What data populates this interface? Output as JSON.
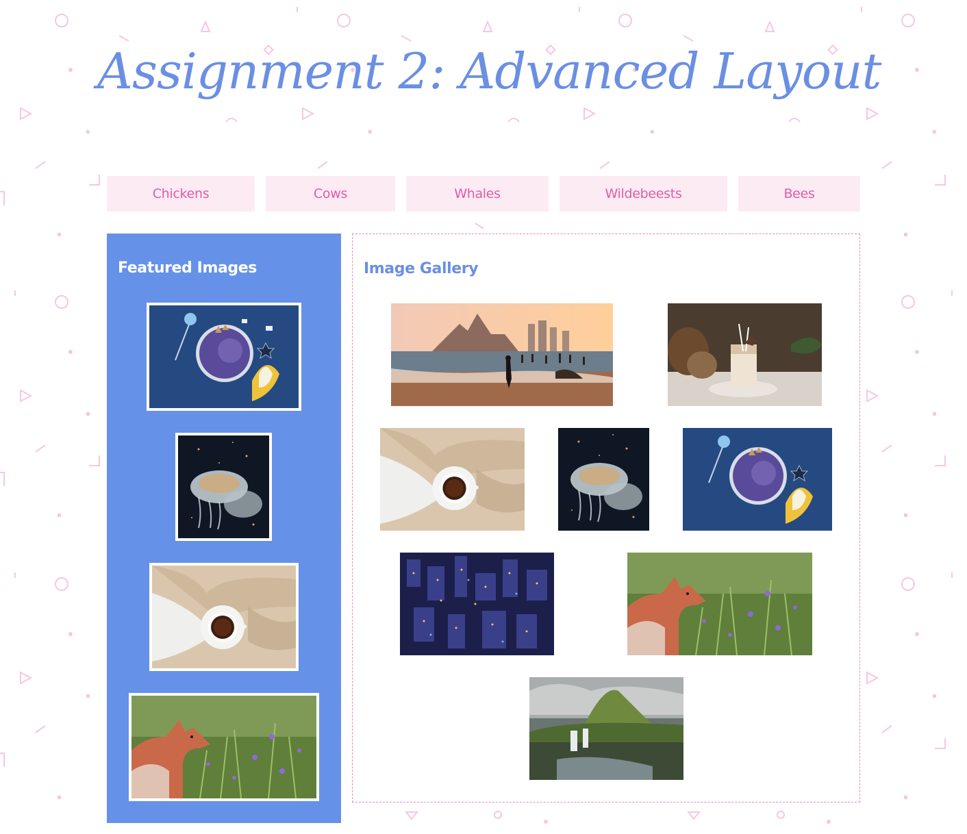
{
  "page": {
    "title": "Assignment 2: Advanced Layout"
  },
  "nav": {
    "items": [
      {
        "label": "Chickens"
      },
      {
        "label": "Cows"
      },
      {
        "label": "Whales"
      },
      {
        "label": "Wildebeests"
      },
      {
        "label": "Bees"
      }
    ]
  },
  "sidebar": {
    "title": "Featured Images",
    "images": [
      {
        "name": "smoothie-bowl-image"
      },
      {
        "name": "jellyfish-image"
      },
      {
        "name": "tea-cup-image"
      },
      {
        "name": "fox-image"
      }
    ]
  },
  "gallery": {
    "title": "Image Gallery",
    "images": [
      {
        "name": "beach-sunset-image"
      },
      {
        "name": "coconut-drink-image"
      },
      {
        "name": "tea-cup-image"
      },
      {
        "name": "jellyfish-image"
      },
      {
        "name": "smoothie-bowl-image"
      },
      {
        "name": "city-night-image"
      },
      {
        "name": "fox-image"
      },
      {
        "name": "waterfall-mountain-image"
      }
    ]
  },
  "colors": {
    "title": "#6a8fe3",
    "nav_bg": "#fdebf4",
    "nav_text": "#e35aa8",
    "sidebar_bg": "#6592e8",
    "gallery_border": "#e08bbd",
    "pattern": "#f7c6e2"
  }
}
